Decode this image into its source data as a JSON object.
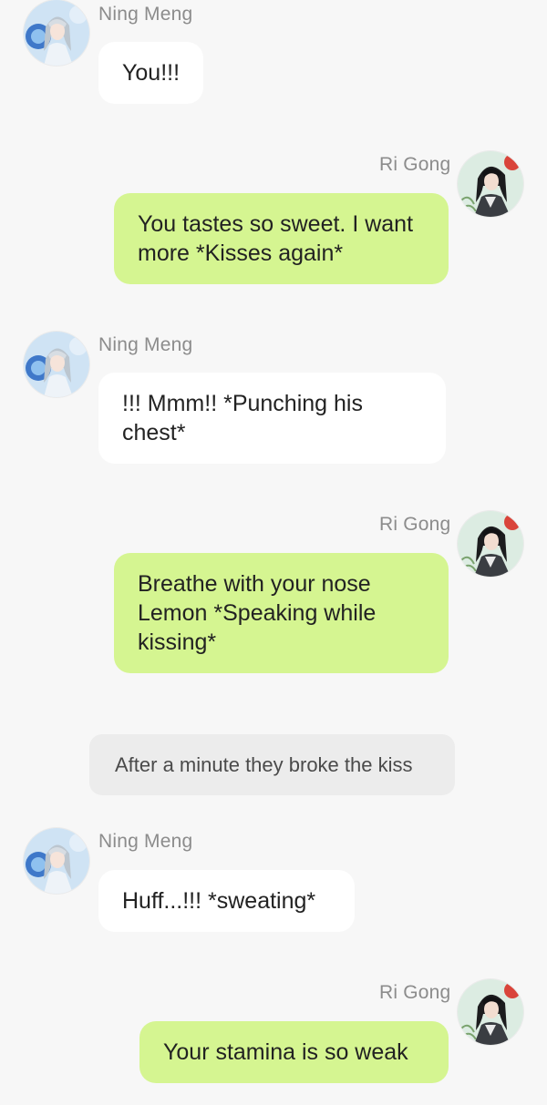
{
  "colors": {
    "background": "#f7f7f7",
    "left_bubble": "#ffffff",
    "right_bubble": "#d5f591",
    "narration_bg": "#ececec",
    "sender_text": "#8c8c8c"
  },
  "characters": {
    "ning": {
      "name": "Ning Meng",
      "avatar_icon": "ning-meng-avatar-icon"
    },
    "ri": {
      "name": "Ri Gong",
      "avatar_icon": "ri-gong-avatar-icon"
    }
  },
  "messages": [
    {
      "sender": "Ning Meng",
      "side": "left",
      "text": "You!!!"
    },
    {
      "sender": "Ri Gong",
      "side": "right",
      "text": "You tastes so sweet. I want more *Kisses again*"
    },
    {
      "sender": "Ning Meng",
      "side": "left",
      "text": "!!! Mmm!! *Punching his chest*"
    },
    {
      "sender": "Ri Gong",
      "side": "right",
      "text": "Breathe with your nose Lemon *Speaking while kissing*"
    },
    {
      "sender": "Ning Meng",
      "side": "left",
      "text": "Huff...!!! *sweating*"
    },
    {
      "sender": "Ri Gong",
      "side": "right",
      "text": "Your stamina is so weak"
    }
  ],
  "narration": {
    "text": "After a minute they broke the kiss"
  }
}
